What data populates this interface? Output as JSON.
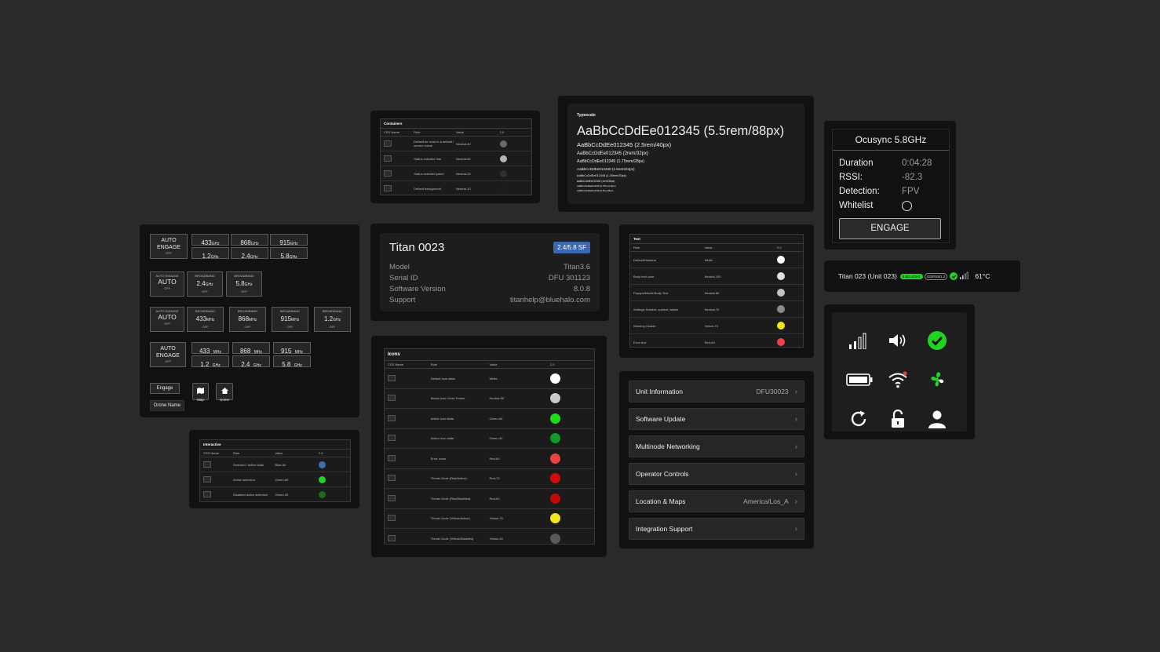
{
  "containers_table": {
    "title": "Containers",
    "headers": [
      "CSS Name",
      "Role",
      "Value",
      "2.0"
    ],
    "rows": [
      {
        "role": "Default for rows in a default / screen colors",
        "value": "Neutral-40",
        "color": "#6a6a6a"
      },
      {
        "role": "Status indicator line",
        "value": "Neutral-60",
        "color": "#b5b5b5"
      },
      {
        "role": "Status selected panel",
        "value": "Neutral-20",
        "color": "#2f2f2f"
      },
      {
        "role": "Default background",
        "value": "Neutral-10",
        "color": "#1c1c1c"
      }
    ]
  },
  "typescale": {
    "title": "Typescale",
    "lines": [
      "AaBbCcDdEe012345 (5.5rem/88px)",
      "AaBbCcDdEe012345 (2.5rem/40px)",
      "AaBbCcDdEe012345 (2rem/32px)",
      "AaBbCcDdEe012345 (1.75rem/28px)",
      "AaBbCcDdEe012345 (1.5rem/24px)",
      "AaBbCcDdEe012345 (1.25rem/20px)",
      "AaBbCcDdEe012345 (1rem/16px)",
      "AaBbCcDdEe012345 (0.75rem/12px)",
      "AaBbCcDdEe012345 (0.5rem/8px)"
    ]
  },
  "ocusync": {
    "title": "Ocusync 5.8GHz",
    "rows": [
      {
        "label": "Duration",
        "value": "0:04:28"
      },
      {
        "label": "RSSI:",
        "value": "-82.3"
      },
      {
        "label": "Detection:",
        "value": "FPV"
      }
    ],
    "whitelist_label": "Whitelist",
    "engage_label": "ENGAGE"
  },
  "status_bar": {
    "unit": "Titan 023 (Unit 023)",
    "badge_green": "5.8/2.4GHz",
    "badge_gray": "433/915/1.2",
    "temp": "61°C"
  },
  "freq_panel": {
    "auto_engage": "AUTO ENGAGE",
    "auto_engage_small": "AUTO ENGAGE",
    "auto": "AUTO",
    "off": "OFF",
    "broadband": "BROADBAND",
    "row1": [
      "433",
      "868",
      "915",
      "1.2",
      "2.4",
      "5.8"
    ],
    "units_ghz": "GHz",
    "units_mhz": "MHz",
    "row2": [
      "2.4",
      "5.8"
    ],
    "row3": [
      "433",
      "868",
      "915",
      "1.2"
    ],
    "row4": [
      "433",
      "868",
      "915",
      "1.2",
      "2.4",
      "5.8"
    ],
    "engage_btn": "Engage",
    "map_btn": "Map",
    "home_btn": "Home",
    "drone_name_btn": "Drone Name"
  },
  "titan_card": {
    "title": "Titan 0023",
    "badge": "2.4/5.8 SF",
    "rows": [
      {
        "label": "Model",
        "value": "Titan3.6"
      },
      {
        "label": "Serial ID",
        "value": "DFU 301123"
      },
      {
        "label": "Software Version",
        "value": "8.0.8"
      },
      {
        "label": "Support",
        "value": "titanhelp@bluehalo.com"
      }
    ]
  },
  "text_table": {
    "title": "Text",
    "headers": [
      "Role",
      "Value",
      "2.0"
    ],
    "rows": [
      {
        "role": "Default/Headers",
        "value": "White",
        "color": "#ffffff"
      },
      {
        "role": "Body text color",
        "value": "Neutral-100",
        "color": "#e0e0e0"
      },
      {
        "role": "Popups/Modal Body Text",
        "value": "Neutral-80",
        "color": "#c2c2c2"
      },
      {
        "role": "Settings Subtext, subtext, labels",
        "value": "Neutral-70",
        "color": "#8a8a8a"
      },
      {
        "role": "Warning Header",
        "value": "Yellow-70",
        "color": "#f2e21a"
      },
      {
        "role": "Error text",
        "value": "Red-60",
        "color": "#f04242"
      }
    ]
  },
  "interactive_table": {
    "title": "Interactive",
    "headers": [
      "CSS Name",
      "Role",
      "Value",
      "2.0"
    ],
    "rows": [
      {
        "role": "Selected / active state",
        "value": "Blue-60",
        "color": "#3d6fb0"
      },
      {
        "role": "Active selection",
        "value": "Green-60",
        "color": "#22d12a"
      },
      {
        "role": "Disabled active selection",
        "value": "Green-30",
        "color": "#1c6a22"
      }
    ]
  },
  "icons_table": {
    "title": "Icons",
    "headers": [
      "CSS Name",
      "Role",
      "Value",
      "2.0"
    ],
    "rows": [
      {
        "role": "Default Icon state",
        "value": "White",
        "color": "#ffffff"
      },
      {
        "role": "Modal Icon Circle Frame",
        "value": "Neutral-90",
        "color": "#c9c9c9"
      },
      {
        "role": "Active Icon state",
        "value": "Green-60",
        "color": "#19e019"
      },
      {
        "role": "Action Icon state",
        "value": "Green-40",
        "color": "#119a24"
      },
      {
        "role": "Error icons",
        "value": "Red-60",
        "color": "#f04242"
      },
      {
        "role": "Threat Circle (Red/Active)",
        "value": "Red-70",
        "color": "#d40b0b"
      },
      {
        "role": "Threat Circle (Red/Disabled)",
        "value": "Red-60",
        "color": "#c40909"
      },
      {
        "role": "Threat Circle (Yellow/Active)",
        "value": "Yellow-70",
        "color": "#f4e51a"
      },
      {
        "role": "Threat Circle (Yellow/Disabled)",
        "value": "Yellow-30",
        "color": "#5a5a5a"
      }
    ]
  },
  "settings_menu": {
    "items": [
      {
        "label": "Unit Information",
        "value": "DFU30023"
      },
      {
        "label": "Software Update",
        "value": ""
      },
      {
        "label": "Multinode Networking",
        "value": ""
      },
      {
        "label": "Operator Controls",
        "value": ""
      },
      {
        "label": "Location & Maps",
        "value": "America/Los_A"
      },
      {
        "label": "Integration Support",
        "value": ""
      }
    ]
  },
  "icon_grid": {
    "icons": [
      "signal-bars-icon",
      "speaker-icon",
      "check-circle-icon",
      "battery-icon",
      "wifi-alert-icon",
      "fan-icon",
      "refresh-icon",
      "unlock-icon",
      "user-icon"
    ],
    "accent": "#1fd51f",
    "alert": "#e0403a"
  }
}
